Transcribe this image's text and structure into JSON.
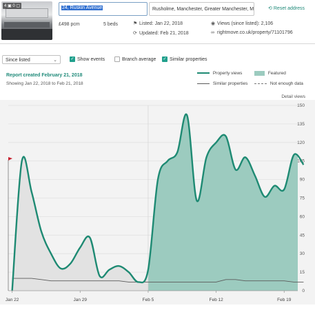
{
  "property": {
    "photo_badge": "4 ▣ 0 ▢",
    "address_line1": "24, Ruskin Avenue",
    "address_line2": "Rusholme, Manchester, Greater Manchester, M",
    "reset_label": "Reset address",
    "price": "£498 pcm",
    "beds": "5 beds",
    "listed": "Listed: Jan 22, 2018",
    "updated": "Updated: Feb 21, 2018",
    "views": "Views (since listed): 2,106",
    "url": "rightmove.co.uk/property/71101796"
  },
  "controls": {
    "range_select": "Since listed",
    "show_events": "Show events",
    "branch_average": "Branch average",
    "similar_properties": "Similar properties",
    "show_events_checked": true,
    "branch_average_checked": false,
    "similar_properties_checked": true
  },
  "report": {
    "title": "Report created February 21, 2018",
    "subtitle": "Showing Jan 22, 2018 to Feb 21, 2018"
  },
  "legend": {
    "property_views": "Property views",
    "featured": "Featured",
    "similar_properties": "Similar properties",
    "not_enough_data": "Not enough data"
  },
  "colors": {
    "accent": "#1f8a79",
    "line": "#1e8a73",
    "featured_fill": "#9ccbbf",
    "not_featured_fill": "#e2e2e2",
    "similar_line": "#5a5a5a",
    "flag": "#c6202f"
  },
  "chart_data": {
    "type": "area",
    "ylabel": "Detail views",
    "ylim": [
      0,
      150
    ],
    "yticks": [
      0,
      15,
      30,
      45,
      60,
      75,
      90,
      105,
      120,
      135,
      150
    ],
    "x_tick_labels": [
      "Jan 22",
      "Jan 29",
      "Feb 5",
      "Feb 12",
      "Feb 19"
    ],
    "x_tick_days": [
      0,
      7,
      14,
      21,
      28
    ],
    "x_range_days": [
      -0.4,
      29.4
    ],
    "featured_from_day": 14,
    "event_flag_day": 0,
    "x_dates": [
      "Jan 22",
      "Jan 23",
      "Jan 24",
      "Jan 25",
      "Jan 26",
      "Jan 27",
      "Jan 28",
      "Jan 29",
      "Jan 30",
      "Jan 31",
      "Feb 1",
      "Feb 2",
      "Feb 3",
      "Feb 4",
      "Feb 5",
      "Feb 6",
      "Feb 7",
      "Feb 8",
      "Feb 9",
      "Feb 10",
      "Feb 11",
      "Feb 12",
      "Feb 13",
      "Feb 14",
      "Feb 15",
      "Feb 16",
      "Feb 17",
      "Feb 18",
      "Feb 19",
      "Feb 20"
    ],
    "series": [
      {
        "name": "Property views",
        "values": [
          0,
          105,
          80,
          48,
          30,
          18,
          22,
          35,
          43,
          12,
          17,
          20,
          15,
          7,
          17,
          90,
          105,
          112,
          142,
          73,
          108,
          120,
          125,
          98,
          108,
          93,
          76,
          85,
          82,
          110,
          102
        ]
      },
      {
        "name": "Similar properties",
        "values": [
          10,
          10,
          10,
          9,
          8,
          8,
          8,
          8,
          8,
          8,
          8,
          8,
          7,
          7,
          7,
          7,
          7,
          7,
          7,
          7,
          7,
          7,
          9,
          9,
          8,
          8,
          8,
          8,
          8,
          7,
          7
        ]
      }
    ]
  }
}
